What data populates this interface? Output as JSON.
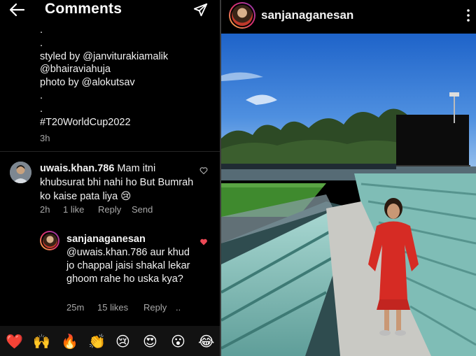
{
  "left_panel": {
    "header": {
      "title": "Comments"
    },
    "caption_lines": [
      ".",
      ".",
      "styled by @janviturakiamalik",
      "@bhairaviahuja",
      "photo by @alokutsav",
      ".",
      ".",
      "#T20WorldCup2022"
    ],
    "caption_time": "3h",
    "comments": [
      {
        "username": "uwais.khan.786",
        "text": "Mam itni khubsurat bhi nahi ho But Bumrah ko kaise pata liya",
        "emoji": "😢",
        "time": "2h",
        "likes": "1 like",
        "reply_label": "Reply",
        "send_label": "Send",
        "liked": false
      },
      {
        "username": "sanjanaganesan",
        "text": "@uwais.khan.786 aur khud jo chappal jaisi shakal lekar ghoom rahe ho uska kya?",
        "time": "25m",
        "likes": "15 likes",
        "reply_label": "Reply",
        "more_label": "..",
        "liked": true
      }
    ],
    "emoji_bar": [
      "❤️",
      "🙌",
      "🔥",
      "👏",
      "😢",
      "😍",
      "😮",
      "😂"
    ]
  },
  "right_panel": {
    "username": "sanjanaganesan"
  },
  "colors": {
    "background": "#000000",
    "secondary_text": "#a8a8a8",
    "like_red": "#ed4956",
    "divider": "#262626"
  },
  "icons": [
    "back-arrow-icon",
    "send-icon",
    "heart-outline-icon",
    "heart-filled-icon",
    "more-vertical-icon"
  ]
}
